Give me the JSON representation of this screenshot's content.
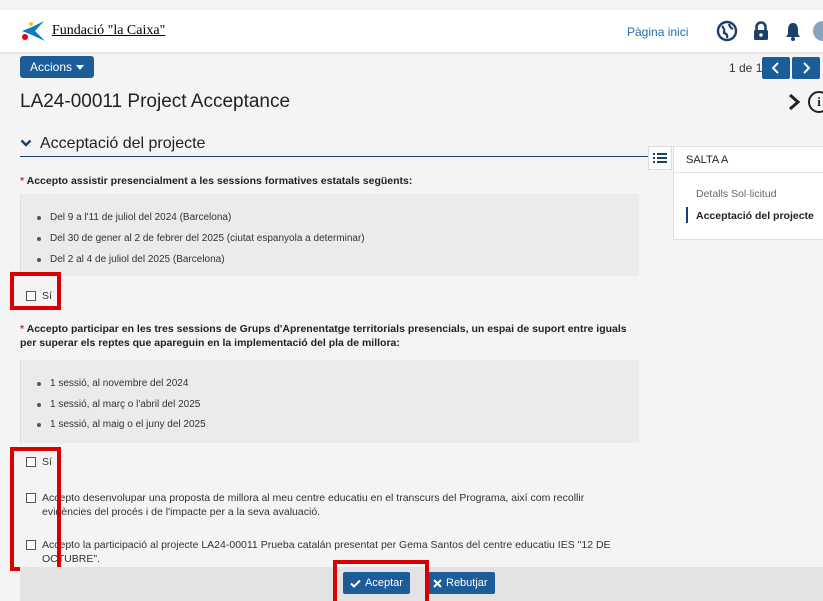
{
  "header": {
    "logo_text": "Fundació \"la Caixa\"",
    "home_link": "Pàgina inici",
    "icons": [
      "globe-icon",
      "lock-icon",
      "bell-icon",
      "user-avatar"
    ]
  },
  "toolbar": {
    "actions_label": "Accions",
    "pager": "1 de 1"
  },
  "page": {
    "title": "LA24-00011 Project Acceptance"
  },
  "section": {
    "title": "Acceptació del projecte"
  },
  "jump_panel": {
    "title": "SALTA A",
    "items": [
      {
        "label": "Detalls Sol·licitud",
        "active": false
      },
      {
        "label": "Acceptació del projecte",
        "active": true
      }
    ]
  },
  "questions": [
    {
      "required_mark": "*",
      "text": "Accepto assistir presencialment a les sessions formatives estatals següents:",
      "items": [
        "Del 9 a l'11 de juliol del 2024 (Barcelona)",
        "Del 30 de gener al 2 de febrer del 2025 (ciutat espanyola a determinar)",
        "Del 2 al 4 de juliol del 2025 (Barcelona)"
      ],
      "checkbox_label": "Sí"
    },
    {
      "required_mark": "*",
      "text": "Accepto participar en les tres sessions de Grups d'Aprenentatge territorials presencials, un espai de suport entre iguals per superar els reptes que apareguin en la implementació del pla de millora:",
      "items": [
        "1 sessió, al novembre del 2024",
        "1 sessió, al març o l'abril del 2025",
        "1 sessió, al maig o el juny del 2025"
      ],
      "checkbox_label": "Sí"
    }
  ],
  "extra_checks": [
    "Accepto desenvolupar una proposta de millora al meu centre educatiu en el transcurs del Programa, així com recollir evidències del procés i de l'impacte per a la seva avaluació.",
    "Accepto la participació al projecte LA24-00011 Prueba catalán presentat per Gema Santos del centre educatiu IES \"12 DE OCTUBRE\"."
  ],
  "footer": {
    "accept_label": "Aceptar",
    "reject_label": "Rebutjar"
  },
  "colors": {
    "primary": "#1c5c99",
    "highlight": "#d80000",
    "required": "#c0392b"
  }
}
